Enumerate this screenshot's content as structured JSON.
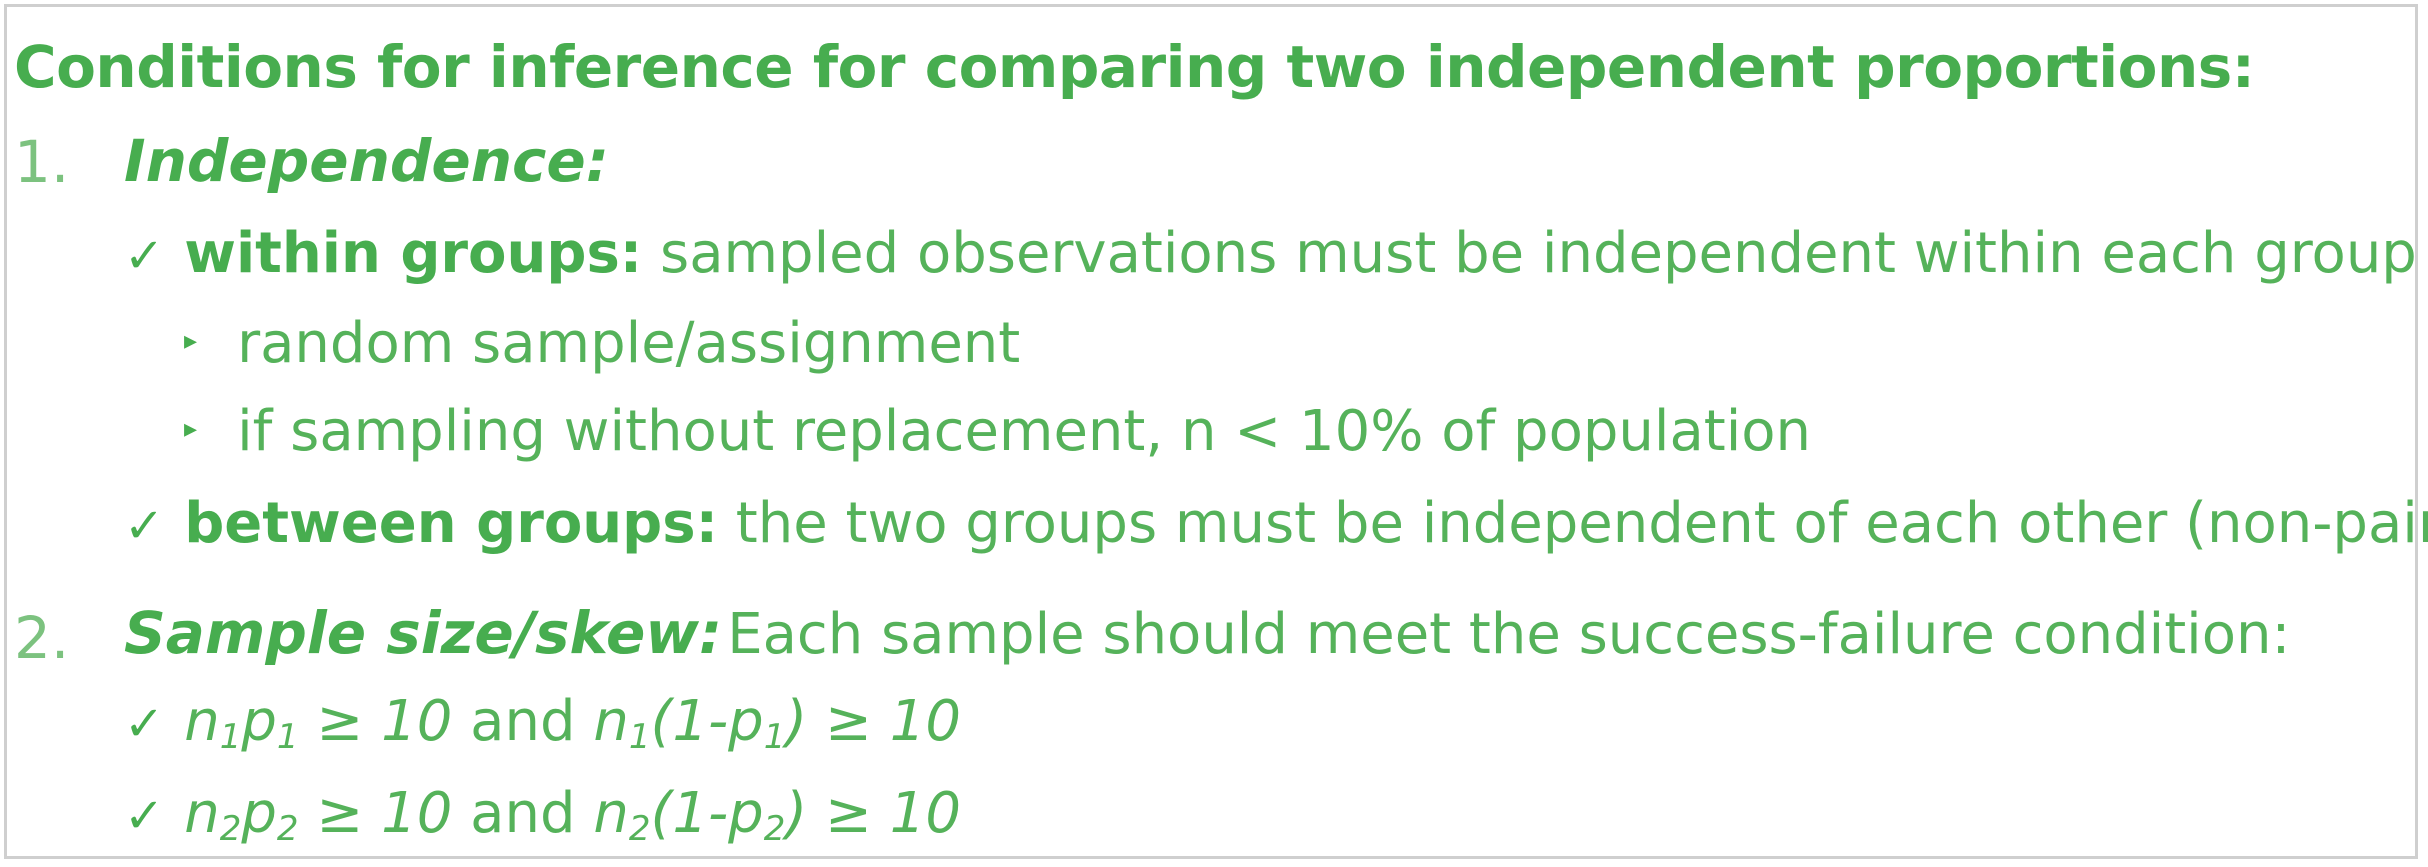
{
  "title": "Conditions for inference for comparing two independent proportions:",
  "item1": {
    "number": "1.",
    "heading": "Independence:",
    "within": {
      "label": "within groups:",
      "text": "sampled observations must be independent within each group",
      "bullets": [
        "random sample/assignment",
        "if sampling without replacement, n < 10% of population"
      ]
    },
    "between": {
      "label": "between groups:",
      "text": "the two groups must be independent of each other (non-paired)"
    }
  },
  "item2": {
    "number": "2.",
    "heading": "Sample size/skew:",
    "text": "Each sample should meet the success-failure condition:",
    "cond1": {
      "a_n": "n",
      "a_n_sub": "1",
      "a_p": "p",
      "a_p_sub": "1",
      "a_rel": "≥ 10",
      "and": "and",
      "b_open": "n",
      "b_n_sub": "1",
      "b_mid": "(1-p",
      "b_p_sub": "1",
      "b_close": ")",
      "b_rel": "≥ 10"
    },
    "cond2": {
      "a_n": "n",
      "a_n_sub": "2",
      "a_p": "p",
      "a_p_sub": "2",
      "a_rel": "≥ 10",
      "and": "and",
      "b_open": "n",
      "b_n_sub": "2",
      "b_mid": "(1-p",
      "b_p_sub": "2",
      "b_close": ")",
      "b_rel": "≥ 10"
    }
  },
  "check_glyph": "✓",
  "bullet_glyph": "▸",
  "colors": {
    "text_green": "#47ad4f",
    "border_gray": "#cfcfcf"
  }
}
